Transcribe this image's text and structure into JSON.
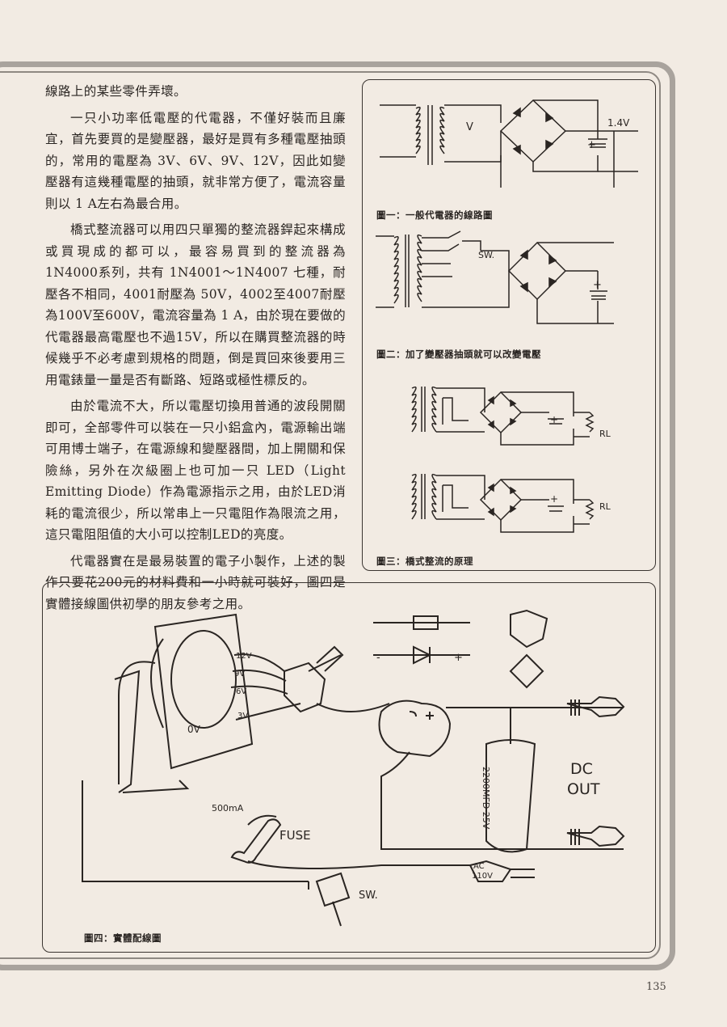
{
  "paragraphs": [
    "線路上的某些零件弄壞。",
    "一只小功率低電壓的代電器，不僅好裝而且廉宜，首先要買的是變壓器，最好是買有多種電壓抽頭的，常用的電壓為 3V、6V、9V、12V，因此如變壓器有這幾種電壓的抽頭，就非常方便了，電流容量則以 1 A左右為最合用。",
    "橋式整流器可以用四只單獨的整流器銲起來構成或買現成的都可以，最容易買到的整流器為 1N4000系列，共有 1N4001～1N4007 七種，耐壓各不相同，4001耐壓為 50V，4002至4007耐壓為100V至600V，電流容量為 1 A，由於現在要做的代電器最高電壓也不過15V，所以在購買整流器的時候幾乎不必考慮到規格的問題，倒是買回來後要用三用電錶量一量是否有斷路、短路或極性標反的。",
    "由於電流不大，所以電壓切換用普通的波段開關即可，全部零件可以裝在一只小鋁盒內，電源輸出端可用博士端子，在電源線和變壓器間，加上開關和保險絲，另外在次級圈上也可加一只 LED（Light Emitting Diode）作為電源指示之用，由於LED消耗的電流很少，所以常串上一只電阻作為限流之用，這只電阻阻值的大小可以控制LED的亮度。",
    "代電器實在是最易裝置的電子小製作，上述的製作只要花200元的材料費和一小時就可裝好，圖四是實體接線圖供初學的朋友參考之用。"
  ],
  "figures": {
    "fig1": {
      "caption": "圖一：一般代電器的線路圖",
      "label_v": "V",
      "label_voltage": "1.4V",
      "label_plus": "+"
    },
    "fig2": {
      "caption": "圖二：加了變壓器抽頭就可以改變電壓",
      "label_sw": "SW.",
      "label_plus": "+"
    },
    "fig3": {
      "caption": "圖三：橋式整流的原理",
      "label_rl": "RL",
      "label_plus": "+"
    },
    "fig4": {
      "caption": "圖四：實體配線圖",
      "tap_12v": "12V",
      "tap_9v": "9V",
      "tap_6v": "6V",
      "tap_3v": "3V",
      "tap_0v": "0V",
      "fuse_rating": "500mA",
      "fuse_label": "FUSE",
      "cap_label": "2200MFD",
      "cap_voltage": "25V",
      "dc_out_1": "DC",
      "dc_out_2": "OUT",
      "ac_label": "AC",
      "ac_voltage": "110V",
      "sw_label": "SW.",
      "minus": "-",
      "plus": "+"
    }
  },
  "page_number": "135",
  "colors": {
    "paper": "#f2ebe3",
    "ink": "#2a2522",
    "frame": "#a9a39d"
  }
}
